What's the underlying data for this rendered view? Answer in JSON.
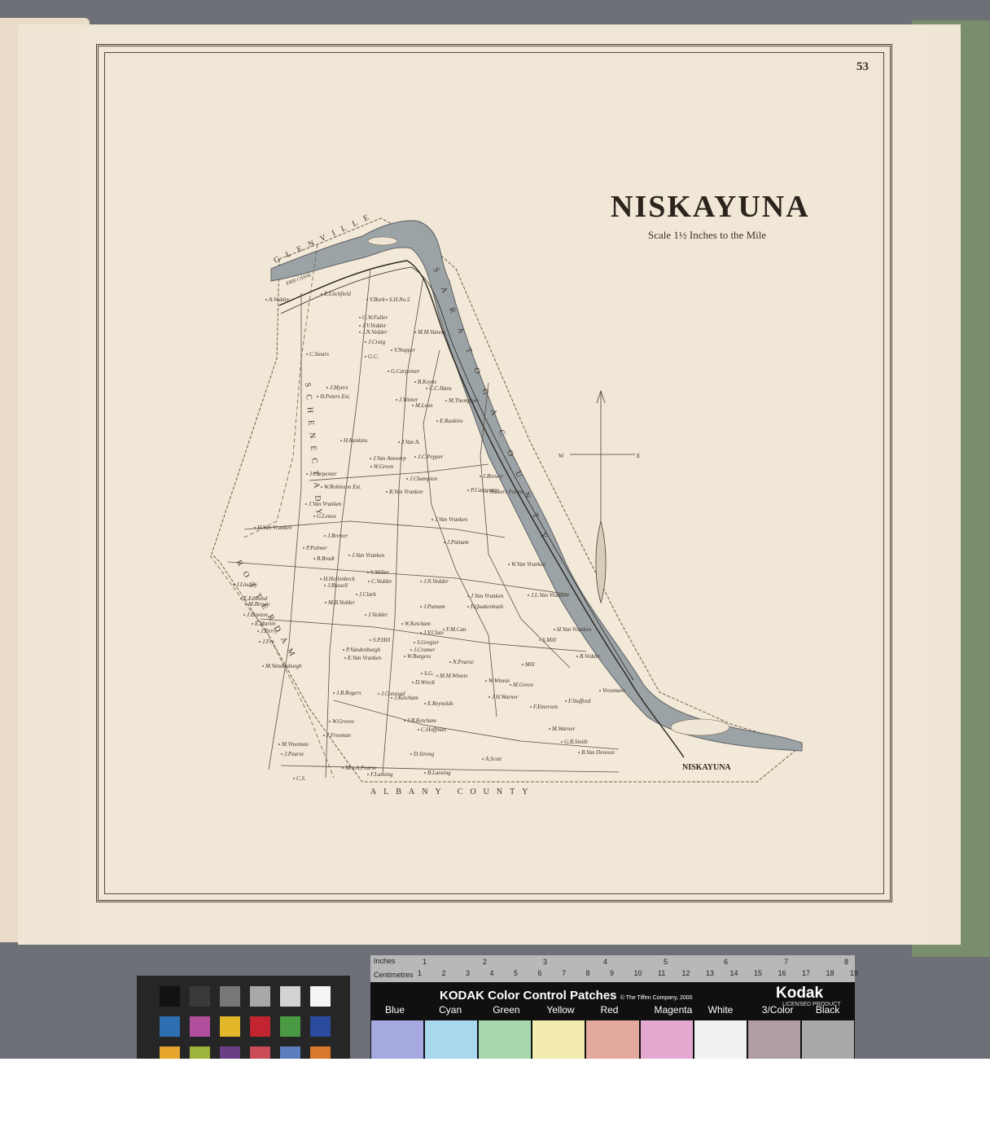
{
  "page_number": "53",
  "map": {
    "title": "NISKAYUNA",
    "scale_text": "Scale 1½ Inches to the Mile",
    "river_labels": [
      "S",
      "A",
      "R",
      "A",
      "T",
      "O",
      "G",
      "A"
    ],
    "region_labels": {
      "glenville": "GLENVILLE",
      "albany_county": "ALBANY COUNTY",
      "schenectady": "SCHENECTADY",
      "rotterdam": "ROTTERDAM",
      "erie_canal": "ERIE CANAL",
      "saratoga_county": "S A R A T O G A   C O U N T Y",
      "town_niskayuna": "NISKAYUNA"
    },
    "compass": {
      "west": "W",
      "east": "E"
    },
    "owners": [
      "A.Vedder",
      "E.Litchfield",
      "V.Bork",
      "S.H.No.5",
      "G.W.Fuller",
      "J.V.Vedder",
      "J.N.Vedder",
      "J.Craig",
      "C.Stears",
      "G.C.",
      "V.Nopper",
      "M.M.Vaness",
      "J.Myers",
      "H.Peters Est.",
      "G.Carpenter",
      "B.Keyns",
      "C.C.Hans",
      "J.Winter",
      "M.Leon",
      "M.Thompson",
      "H.Rankins",
      "J.Van A.",
      "E.Rankins",
      "J.Van Antwerp",
      "W.Green",
      "J.C.Pepper",
      "J.Champion",
      "J.Carpenter",
      "W.Robinson Est.",
      "J.Brewer",
      "R.Van Vranken",
      "P.Carpenter",
      "Shakers Farms",
      "J.Van Vranken",
      "G.Lenox",
      "J.Van Vranken",
      "J.Putnam",
      "H.Van Vranken",
      "J.Brewer",
      "P.Palmer",
      "B.Bradt",
      "J.Van Vranken",
      "W.Van Vranken",
      "H.Hollenbeck",
      "S.Miller",
      "C.Vedder",
      "J.N.Vedder",
      "J.Russell",
      "J.Clark",
      "J.Van Vranken",
      "J.L.Van Vranken",
      "M.B.Vedder",
      "J.Putnam",
      "F.Quakenbush",
      "J.Lindley",
      "E.Edmond",
      "M.Brown",
      "J.Lawton",
      "E.Martin",
      "J.Perry",
      "J.Fry",
      "J.Vedder",
      "W.Ketcham",
      "J.V.Clute",
      "F.M.Can",
      "S.P.Hill",
      "J.Cramer",
      "S.Gregier",
      "W.Burgess",
      "H.Van Vranken",
      "S.Mill",
      "P.Vandenburgh",
      "M.Vandenburgh",
      "E.Van Vranken",
      "S.G.",
      "D.Wreck",
      "N.Pearse",
      "M.M.Winnie",
      "W.Winnie",
      "Mill",
      "M.Green",
      "B.Vedder",
      "J.B.Rogers",
      "J.Conroad",
      "J.Ketcham",
      "E.Reynolds",
      "J.H.Warner",
      "F.Emerson",
      "F.Stafford",
      "W.Groves",
      "J.Freeman",
      "J.B.Ketcham",
      "C.Hoffman",
      "Vroomans",
      "M.Vrooman",
      "J.Pearse",
      "D.Strong",
      "A.Scott",
      "M.Warner",
      "G.B.Smith",
      "B.Van Dewson",
      "F.Lansing",
      "B.Lansing",
      "C.S.",
      "Mrs.A.Pearse"
    ]
  },
  "color_card": {
    "inches_label": "Inches",
    "centimetres_label": "Centimetres",
    "title": "KODAK Color Control Patches",
    "copyright": "© The Tiffen Company, 2000",
    "brand": "Kodak",
    "licensed": "LICENSED PRODUCT",
    "inch_ticks": [
      "1",
      "2",
      "3",
      "4",
      "5",
      "6",
      "7",
      "8"
    ],
    "cm_ticks": [
      "1",
      "2",
      "3",
      "4",
      "5",
      "6",
      "7",
      "8",
      "9",
      "10",
      "11",
      "12",
      "13",
      "14",
      "15",
      "16",
      "17",
      "18",
      "19"
    ],
    "patch_names": [
      "Blue",
      "Cyan",
      "Green",
      "Yellow",
      "Red",
      "Magenta",
      "White",
      "3/Color",
      "Black"
    ],
    "patch_colors": [
      "#a6a9e0",
      "#a8d7ee",
      "#a9d8ae",
      "#f2ecb0",
      "#e4a99d",
      "#e2a8d0",
      "#f1f1f1",
      "#b09ea2",
      "#a9a9a9"
    ]
  },
  "gray_card_colors": [
    "#111111",
    "#3a3a3a",
    "#777777",
    "#a8a8a8",
    "#d3d3d3",
    "#f5f5f5",
    "#2d6fb1",
    "#b14f9c",
    "#e2b72a",
    "#c2252f",
    "#4a9a43",
    "#294a9d",
    "#e6a52d",
    "#9bb43a",
    "#6b3f86",
    "#cc4b58",
    "#5a7dc0",
    "#d9782a"
  ]
}
